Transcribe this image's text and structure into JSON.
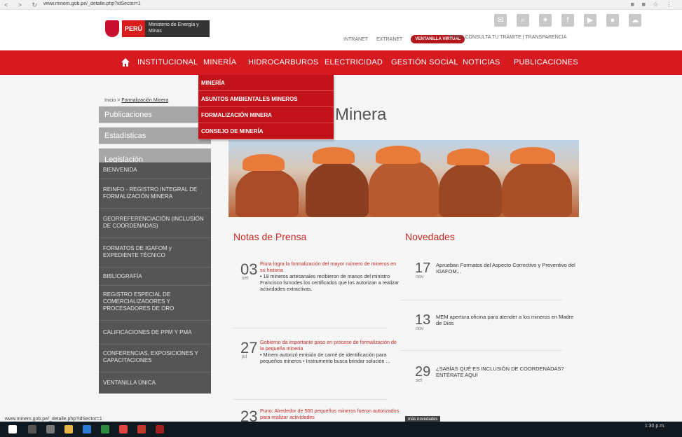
{
  "browser": {
    "url": "www.minem.gob.pe/_detalle.php?idSector=1",
    "nav_icons": "< > ↻"
  },
  "header": {
    "logo_peru": "PERÚ",
    "logo_ministry": "Ministerio de Energía y Minas",
    "links": [
      "INTRANET",
      "EXTRANET"
    ],
    "pill": "VENTANILLA VIRTUAL",
    "links2": "TUPA | CONSULTA TU TRÁMITE | TRANSPARENCIA"
  },
  "nav": {
    "items": [
      "INSTITUCIONAL",
      "MINERÍA",
      "HIDROCARBUROS",
      "ELECTRICIDAD",
      "GESTIÓN SOCIAL",
      "NOTICIAS",
      "PUBLICACIONES"
    ]
  },
  "dropdown": {
    "items": [
      "MINERÍA",
      "ASUNTOS AMBIENTALES MINEROS",
      "FORMALIZACIÓN MINERA",
      "CONSEJO DE MINERÍA"
    ]
  },
  "breadcrumb": {
    "home": "Inicio",
    "current": "Formalización Minera"
  },
  "left_tabs": [
    "Publicaciones",
    "Estadísticas",
    "Legislación"
  ],
  "left_menu": [
    "BIENVENIDA",
    "REINFO - REGISTRO INTEGRAL DE FORMALIZACIÓN MINERA",
    "GEORREFERENCIACIÓN (INCLUSIÓN DE COORDENADAS)",
    "FORMATOS DE IGAFOM y EXPEDIENTE TÉCNICO",
    "BIBLIOGRAFÍA",
    "REGISTRO ESPECIAL DE COMERCIALIZADORES Y PROCESADORES DE ORO",
    "CALIFICACIONES DE PPM Y PMA",
    "CONFERENCIAS, EXPOSICIONES Y CAPACITACIONES",
    "VENTANILLA ÚNICA"
  ],
  "page_title": "Minera",
  "notas": {
    "title": "Notas de Prensa",
    "items": [
      {
        "day": "03",
        "mon": "set",
        "headline": "Piura logra la formalización del mayor número de mineros en su historia",
        "body": "• 18 mineros artesanales recibieron de manos del ministro Francisco Ísmodes los certificados que los autorizan a realizar actividades extractivas."
      },
      {
        "day": "27",
        "mon": "jul",
        "headline": "Gobierno da importante paso en proceso de formalización de la pequeña minería",
        "body": "• Minem autorizó emisión de carné de identificación para pequeños mineros • Instrumento busca brindar solución ..."
      },
      {
        "day": "23",
        "mon": "",
        "headline": "Puno: Alrededor de 500 pequeños mineros fueron autorizados para realizar actividades",
        "body": ""
      }
    ]
  },
  "novedades": {
    "title": "Novedades",
    "items": [
      {
        "day": "17",
        "mon": "nov",
        "text": "Aprueban Formatos del Aspecto Correctivo y Preventivo del IGAFOM..."
      },
      {
        "day": "13",
        "mon": "nov",
        "text": "MEM apertura oficina para atender a los mineros en Madre de Dios"
      },
      {
        "day": "29",
        "mon": "set",
        "text": "¿SABÍAS QUÉ ES INCLUSIÓN DE COORDENADAS? ENTÉRATE AQUÍ"
      }
    ],
    "more": "más novedades"
  },
  "taskbar": {
    "time": "1:30 p.m."
  }
}
